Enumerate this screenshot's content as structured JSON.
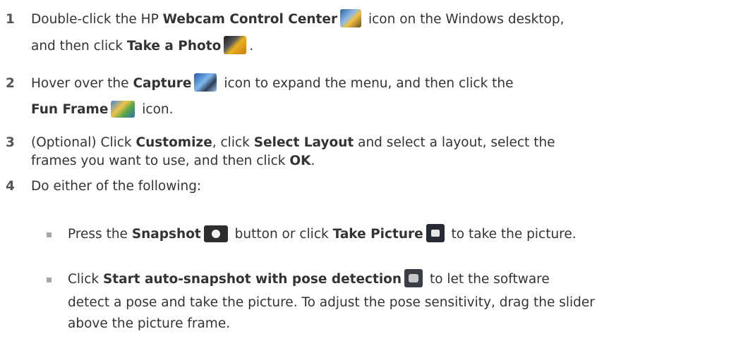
{
  "steps": [
    {
      "number": "1",
      "line1_a": "Double-click the HP ",
      "line1_b": "Webcam Control Center",
      "line1_c": " icon on the Windows desktop,",
      "line2_a": "and then click ",
      "line2_b": "Take a Photo",
      "line2_c": ".",
      "icons": [
        "webcam-control-center-icon",
        "take-a-photo-icon"
      ]
    },
    {
      "number": "2",
      "line1_a": "Hover over the ",
      "line1_b": "Capture",
      "line1_c": " icon to expand the menu, and then click the",
      "line2_b": "Fun Frame",
      "line2_c": " icon.",
      "icons": [
        "capture-icon",
        "fun-frame-icon"
      ]
    },
    {
      "number": "3",
      "line1_a": "(Optional) Click ",
      "line1_b": "Customize",
      "line1_c": ", click ",
      "line1_d": "Select Layout",
      "line1_e": " and select a layout, select the",
      "line2_a": "frames you want to use, and then click ",
      "line2_b": "OK",
      "line2_c": "."
    },
    {
      "number": "4",
      "line1_a": "Do either of the following:"
    }
  ],
  "options": [
    {
      "a": "Press the ",
      "b": "Snapshot",
      "c": " button or click ",
      "d": "Take Picture",
      "e": " to take the picture.",
      "icons": [
        "snapshot-button-icon",
        "take-picture-icon"
      ]
    },
    {
      "a": "Click ",
      "b": "Start auto-snapshot with pose detection",
      "c": " to let the software",
      "line2": "detect a pose and take the picture. To adjust the pose sensitivity, drag the slider",
      "line3": "above the picture frame.",
      "icons": [
        "pose-detection-icon"
      ]
    }
  ],
  "colors": {
    "text": "#333333",
    "number": "#555555",
    "bullet": "#a7a7a7"
  }
}
